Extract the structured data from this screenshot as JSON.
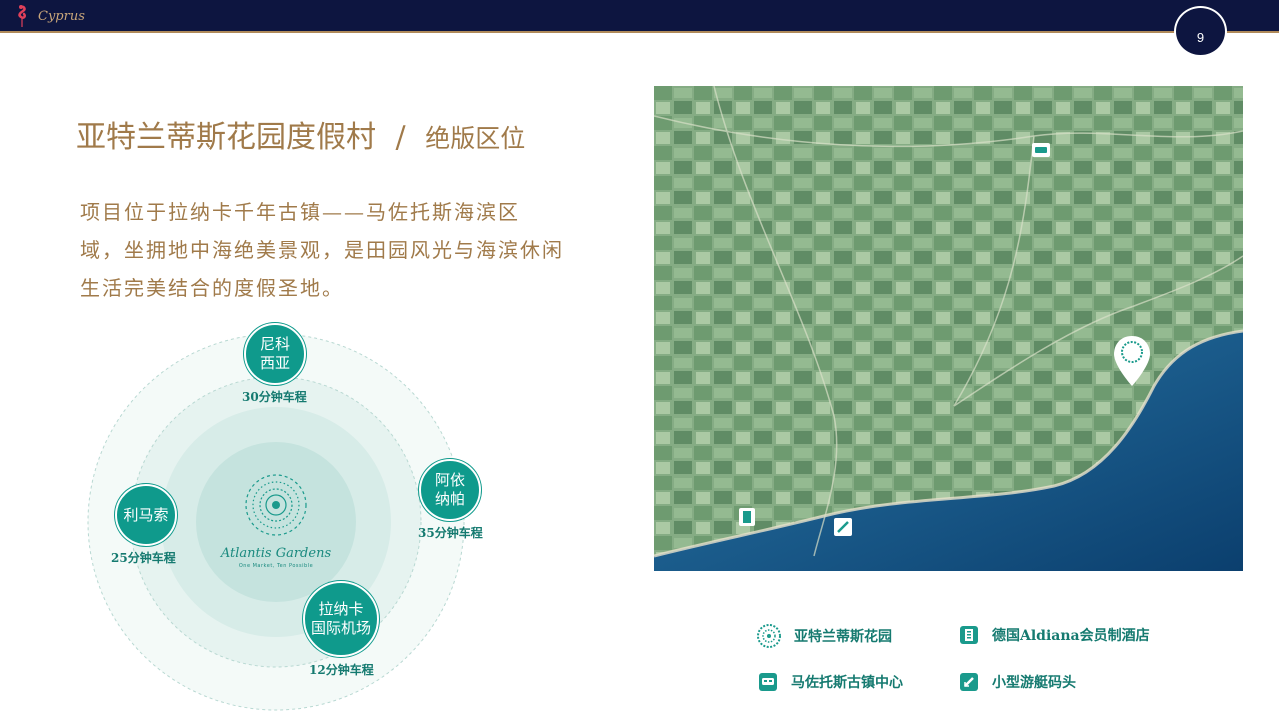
{
  "header": {
    "logo_text": "Cyprus",
    "page_number": "9"
  },
  "title": {
    "main": "亚特兰蒂斯花园度假村",
    "separator": "/",
    "sub": "绝版区位"
  },
  "description": [
    "项目位于拉纳卡千年古镇——马佐托斯海滨区",
    "域，坐拥地中海绝美景观，是田园风光与海滨休闲",
    "生活完美结合的度假圣地。"
  ],
  "distance_diagram": {
    "center": {
      "brand": "Atlantis Gardens",
      "tagline": "One Market, Ten Possible"
    },
    "nodes": [
      {
        "line1": "尼科",
        "line2": "西亚",
        "drive_time": "30分钟车程"
      },
      {
        "line1": "阿依",
        "line2": "纳帕",
        "drive_time": "35分钟车程"
      },
      {
        "line1": "利马索",
        "line2": "",
        "drive_time": "25分钟车程"
      },
      {
        "line1": "拉纳卡",
        "line2": "国际机场",
        "drive_time": "12分钟车程"
      }
    ]
  },
  "legend": {
    "gardens": "亚特兰蒂斯花园",
    "hotel": "德国Aldiana会员制酒店",
    "town": "马佐托斯古镇中心",
    "marina": "小型游艇码头"
  },
  "colors": {
    "navy": "#0d1540",
    "gold": "#a07a4a",
    "teal": "#0f9a8c",
    "sea": "#0d4a78",
    "land": "#6a9a6a"
  },
  "icons": [
    "flamingo-icon",
    "sunburst-logo-icon",
    "map-pin-icon",
    "hotel-icon",
    "bus-icon",
    "marina-icon"
  ]
}
